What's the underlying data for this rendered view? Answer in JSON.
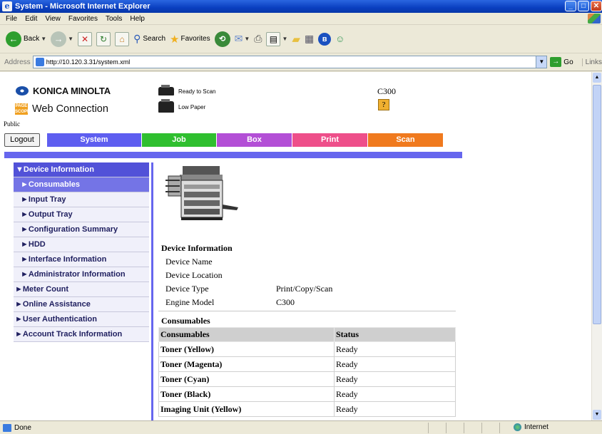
{
  "window": {
    "title": "System - Microsoft Internet Explorer"
  },
  "menubar": [
    "File",
    "Edit",
    "View",
    "Favorites",
    "Tools",
    "Help"
  ],
  "toolbar": {
    "back": "Back",
    "search": "Search",
    "favorites": "Favorites"
  },
  "address": {
    "label": "Address",
    "url": "http://10.120.3.31/system.xml",
    "go": "Go",
    "links": "Links"
  },
  "status_bar": {
    "left": "Done",
    "zone": "Internet"
  },
  "page": {
    "brand": "KONICA MINOLTA",
    "product": "Web Connection",
    "pagescope": "PAGE SCOPE",
    "user_mode": "Public",
    "device_status": [
      "Ready to Scan",
      "Low Paper"
    ],
    "model": "C300",
    "help_label": "?",
    "logout": "Logout",
    "tabs": [
      {
        "label": "System",
        "color": "#5e5ef0"
      },
      {
        "label": "Job",
        "color": "#2fbf2f"
      },
      {
        "label": "Box",
        "color": "#b34fd6"
      },
      {
        "label": "Print",
        "color": "#ee4f8a"
      },
      {
        "label": "Scan",
        "color": "#f07a1e"
      }
    ],
    "sidebar": [
      {
        "label": "▼Device Information",
        "level": "head"
      },
      {
        "label": "►Consumables",
        "level": "sel"
      },
      {
        "label": "►Input Tray",
        "level": "l1"
      },
      {
        "label": "►Output Tray",
        "level": "l1"
      },
      {
        "label": "►Configuration Summary",
        "level": "l1"
      },
      {
        "label": "►HDD",
        "level": "l1"
      },
      {
        "label": "►Interface Information",
        "level": "l1"
      },
      {
        "label": "►Administrator Information",
        "level": "l1"
      },
      {
        "label": "►Meter Count",
        "level": "l0"
      },
      {
        "label": "►Online Assistance",
        "level": "l0"
      },
      {
        "label": "►User Authentication",
        "level": "l0"
      },
      {
        "label": "►Account Track Information",
        "level": "l0"
      }
    ],
    "device_info": {
      "title": "Device Information",
      "rows": [
        {
          "key": "Device Name",
          "value": ""
        },
        {
          "key": "Device Location",
          "value": ""
        },
        {
          "key": "Device Type",
          "value": "Print/Copy/Scan"
        },
        {
          "key": "Engine Model",
          "value": "C300"
        }
      ]
    },
    "consumables": {
      "title": "Consumables",
      "headers": [
        "Consumables",
        "Status"
      ],
      "rows": [
        [
          "Toner (Yellow)",
          "Ready"
        ],
        [
          "Toner (Magenta)",
          "Ready"
        ],
        [
          "Toner (Cyan)",
          "Ready"
        ],
        [
          "Toner (Black)",
          "Ready"
        ],
        [
          "Imaging Unit (Yellow)",
          "Ready"
        ]
      ]
    }
  }
}
